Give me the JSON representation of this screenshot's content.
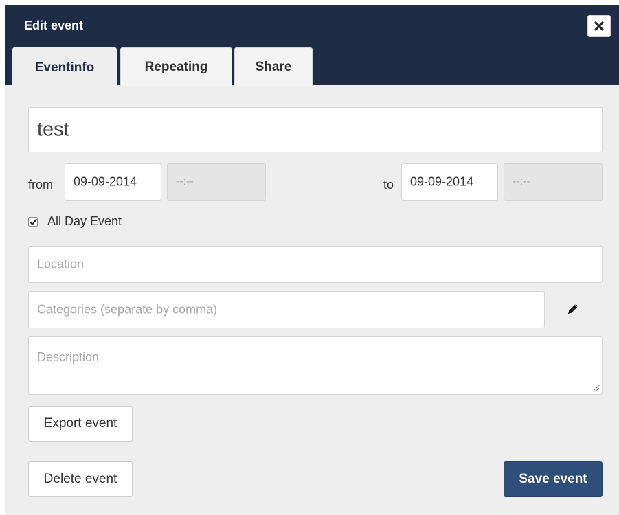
{
  "dialog": {
    "title": "Edit event",
    "close_icon": "close-icon",
    "tabs": [
      {
        "label": "Eventinfo",
        "active": true
      },
      {
        "label": "Repeating",
        "active": false
      },
      {
        "label": "Share",
        "active": false
      }
    ]
  },
  "form": {
    "title_value": "test",
    "from_label": "from",
    "from_date": "09-09-2014",
    "from_time_placeholder": "--:--",
    "to_label": "to",
    "to_date": "09-09-2014",
    "to_time_placeholder": "--:--",
    "all_day_label": "All Day Event",
    "all_day_checked": true,
    "location_placeholder": "Location",
    "categories_placeholder": "Categories (separate by comma)",
    "categories_edit_icon": "pencil-icon",
    "description_placeholder": "Description"
  },
  "buttons": {
    "export": "Export event",
    "delete": "Delete event",
    "save": "Save event"
  },
  "colors": {
    "header": "#1e2d45",
    "body": "#eeeeee",
    "primary": "#2f4f7a"
  }
}
